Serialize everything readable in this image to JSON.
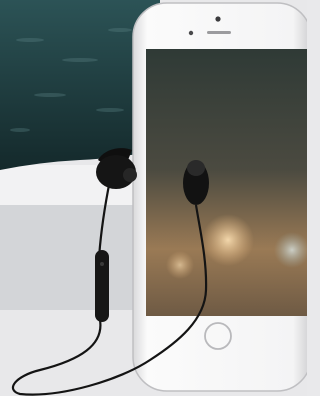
{
  "scene": {
    "subject": "product-photo",
    "items": [
      "wireless-earphones",
      "smartphone"
    ],
    "colors": {
      "background_top": "#1f3a3d",
      "background_mid": "#cfd1d4",
      "background_bottom": "#e8e8ea",
      "phone_body": "#f3f3f4",
      "screen_dark": "#3a3f3a",
      "screen_warm": "#c8a57c",
      "bokeh": "#e8c79a",
      "earphone": "#121212"
    }
  }
}
